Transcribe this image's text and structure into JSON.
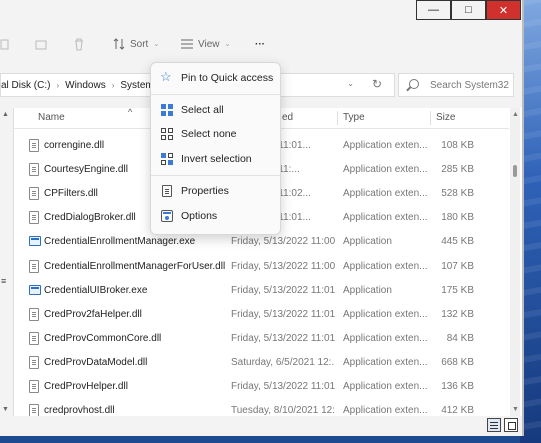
{
  "window": {
    "controls": {
      "minimize": "—",
      "maximize": "□",
      "close": "✕"
    }
  },
  "commandbar": {
    "sort_label": "Sort",
    "view_label": "View",
    "more_label": "···"
  },
  "address": {
    "segments": [
      "al Disk (C:)",
      "Windows",
      "System32"
    ],
    "visible_text": "System"
  },
  "search": {
    "placeholder": "Search System32"
  },
  "columns": {
    "name": "Name",
    "date": "Date modified",
    "type": "Type",
    "size": "Size",
    "date_visible": "ed"
  },
  "menu": {
    "items": [
      {
        "label": "Pin to Quick access",
        "icon": "star-icon"
      },
      {
        "label": "Select all",
        "icon": "select-all-icon"
      },
      {
        "label": "Select none",
        "icon": "select-none-icon"
      },
      {
        "label": "Invert selection",
        "icon": "invert-selection-icon"
      },
      {
        "label": "Properties",
        "icon": "properties-icon"
      },
      {
        "label": "Options",
        "icon": "options-icon"
      }
    ]
  },
  "files": [
    {
      "name": "correngine.dll",
      "date": "5/13/2022 11:01...",
      "type": "Application exten...",
      "size": "108 KB",
      "kind": "dll"
    },
    {
      "name": "CourtesyEngine.dll",
      "date": "5/13/2022 11:...",
      "type": "Application exten...",
      "size": "285 KB",
      "kind": "dll"
    },
    {
      "name": "CPFilters.dll",
      "date": "5/13/2022 11:02...",
      "type": "Application exten...",
      "size": "528 KB",
      "kind": "dll"
    },
    {
      "name": "CredDialogBroker.dll",
      "date": "5/13/2022 11:01...",
      "type": "Application exten...",
      "size": "180 KB",
      "kind": "dll"
    },
    {
      "name": "CredentialEnrollmentManager.exe",
      "date": "Friday, 5/13/2022 11:00...",
      "type": "Application",
      "size": "445 KB",
      "kind": "exe"
    },
    {
      "name": "CredentialEnrollmentManagerForUser.dll",
      "date": "Friday, 5/13/2022 11:00...",
      "type": "Application exten...",
      "size": "107 KB",
      "kind": "dll"
    },
    {
      "name": "CredentialUIBroker.exe",
      "date": "Friday, 5/13/2022 11:01...",
      "type": "Application",
      "size": "175 KB",
      "kind": "exe"
    },
    {
      "name": "CredProv2faHelper.dll",
      "date": "Friday, 5/13/2022 11:01...",
      "type": "Application exten...",
      "size": "132 KB",
      "kind": "dll"
    },
    {
      "name": "CredProvCommonCore.dll",
      "date": "Friday, 5/13/2022 11:01...",
      "type": "Application exten...",
      "size": "84 KB",
      "kind": "dll"
    },
    {
      "name": "CredProvDataModel.dll",
      "date": "Saturday, 6/5/2021 12:...",
      "type": "Application exten...",
      "size": "668 KB",
      "kind": "dll"
    },
    {
      "name": "CredProvHelper.dll",
      "date": "Friday, 5/13/2022 11:01...",
      "type": "Application exten...",
      "size": "136 KB",
      "kind": "dll"
    },
    {
      "name": "credprovhost.dll",
      "date": "Tuesday, 8/10/2021 12:...",
      "type": "Application exten...",
      "size": "412 KB",
      "kind": "dll"
    }
  ]
}
